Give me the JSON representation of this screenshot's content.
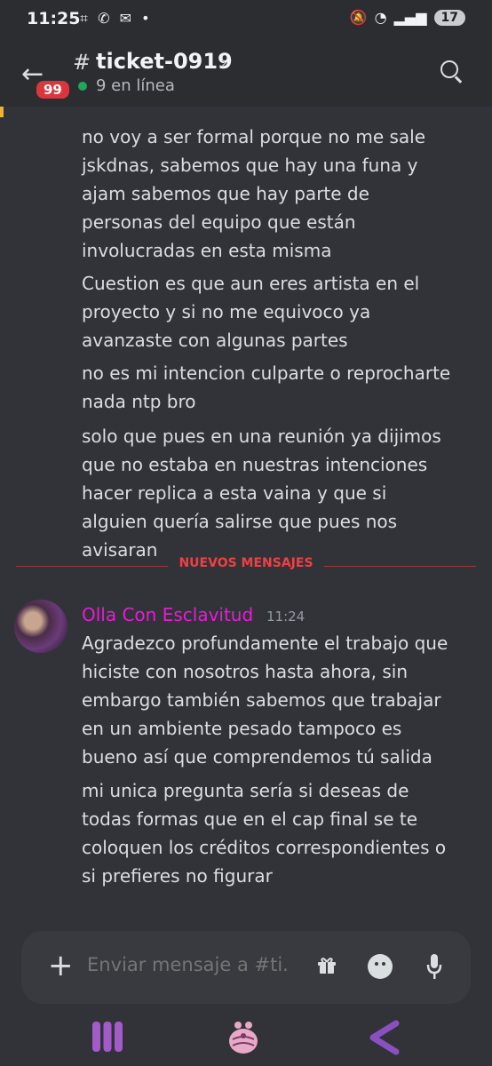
{
  "status_bar": {
    "time": "11:25",
    "battery": "17"
  },
  "header": {
    "channel": "ticket-0919",
    "unread_badge": "99",
    "online": "9 en línea"
  },
  "messages_top": [
    "no voy a ser formal porque no me sale jskdnas, sabemos que hay una funa y ajam sabemos que hay parte de personas del equipo que están involucradas en esta misma",
    "Cuestion es que aun eres artista en el proyecto y si no me equivoco ya avanzaste con algunas partes",
    "no es mi intencion culparte o reprocharte nada ntp bro",
    "solo que pues en una reunión ya dijimos que no estaba en nuestras intenciones hacer replica a esta vaina y que si alguien quería salirse que pues nos avisaran"
  ],
  "divider": "NUEVOS MENSAJES",
  "new_message": {
    "author": "Olla Con Esclavitud",
    "time": "11:24",
    "paragraphs": [
      "Agradezco profundamente el trabajo que hiciste con nosotros hasta ahora, sin embargo también sabemos que trabajar en un ambiente pesado tampoco es bueno así que comprendemos tú salida",
      "mi unica pregunta sería si deseas de todas formas que en el cap final se te coloquen los créditos correspondientes o si prefieres no figurar"
    ]
  },
  "composer": {
    "placeholder": "Enviar mensaje a #ti..."
  },
  "colors": {
    "accent_author": "#e91bd6",
    "divider": "#f23f43",
    "online": "#23a55a",
    "background": "#313338"
  }
}
